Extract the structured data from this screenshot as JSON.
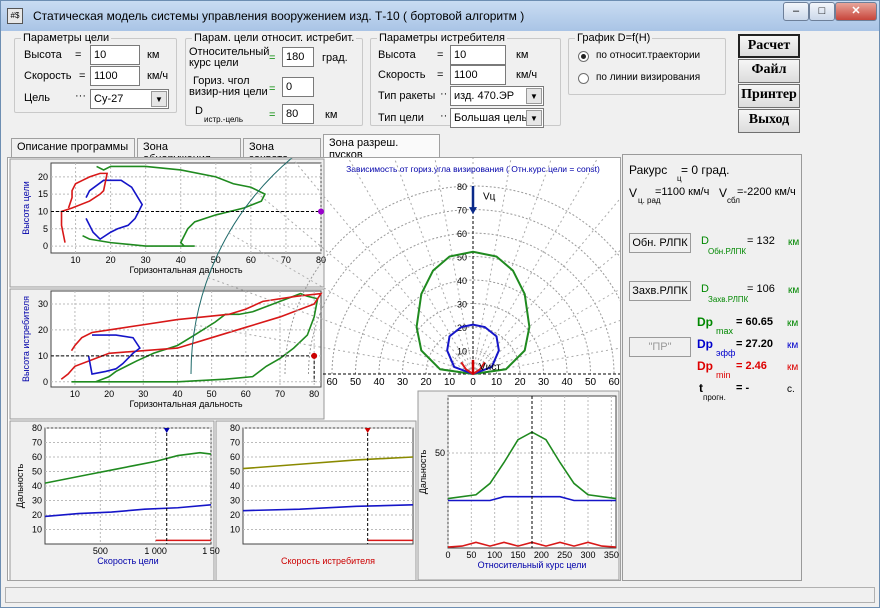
{
  "window": {
    "title": "Статическая модель системы управления вооружением  изд. Т-10  ( бортовой алгоритм )",
    "icon": "#$",
    "min": "–",
    "max": "□",
    "close": "✕"
  },
  "target_params": {
    "title": "Параметры цели",
    "altitude_label": "Высота",
    "altitude_eq": "=",
    "altitude": "10",
    "altitude_unit": "км",
    "speed_label": "Скорость",
    "speed_eq": "=",
    "speed": "1100",
    "speed_unit": "км/ч",
    "target_label": "Цель",
    "target_dots": "···",
    "target": "Су-27"
  },
  "rel_params": {
    "title": "Парам. цели относит. истребит.",
    "course_label1": "Относительный",
    "course_label2": "курс цели",
    "course_eq": "=",
    "course": "180",
    "course_unit": "град.",
    "angle_label1": "Гориз. чгол",
    "angle_label2": "визир-ния цели",
    "angle_eq": "=",
    "angle": "0",
    "d_label": "D",
    "d_sub": "истр.-цель",
    "d_eq": "=",
    "d": "80",
    "d_unit": "км"
  },
  "fighter_params": {
    "title": "Параметры истребителя",
    "altitude_label": "Высота",
    "altitude_eq": "=",
    "altitude": "10",
    "altitude_unit": "км",
    "speed_label": "Скорость",
    "speed_eq": "=",
    "speed": "1100",
    "speed_unit": "км/ч",
    "missile_label": "Тип ракеты",
    "missile_dots": "··",
    "missile": "изд. 470.ЭР",
    "target_type_label": "Тип цели",
    "target_type_dots": "··",
    "target_type": "Большая цель"
  },
  "graph_opts": {
    "title": "График  D=f(H)",
    "opt1": "по относит.траектории",
    "opt2": "по линии визирования",
    "selected": 0
  },
  "buttons": {
    "calc": "Расчет",
    "file": "Файл",
    "printer": "Принтер",
    "exit": "Выход"
  },
  "tabs": [
    "Описание программы",
    "Зона обнаружения",
    "Зона захвата",
    "Зона разреш. пусков"
  ],
  "active_tab": 3,
  "right": {
    "rakurs": "Ракурс",
    "rakurs_sub": "ц",
    "rakurs_val": "= 0 град.",
    "v_label": "V",
    "v_sub": "ц. рад",
    "v_val": "=1100 км/ч",
    "vs_label": "V",
    "vs_sub": "сбл",
    "vs_val": "=-2200 км/ч",
    "obn_btn": "Обн. РЛПК",
    "obn_d": "D",
    "obn_sub": "Обн.РЛПК",
    "obn_val": "=   132",
    "obn_unit": "км",
    "zahv_btn": "Захв.РЛПК",
    "zahv_d": "D",
    "zahv_sub": "Захв.РЛПК",
    "zahv_val": "=   106",
    "zahv_unit": "км",
    "pr_btn": "\"ПР\"",
    "dpmax_l": "Dp",
    "dpmax_s": "max",
    "dpmax_v": "=   60.65",
    "dpmax_u": "км",
    "dpeff_l": "Dp",
    "dpeff_s": "эфф",
    "dpeff_v": "=   27.20",
    "dpeff_u": "км",
    "dpmin_l": "Dp",
    "dpmin_s": "min",
    "dpmin_v": "=    2.46",
    "dpmin_u": "км",
    "t_l": "t",
    "t_s": "прогн.",
    "t_v": "=     -",
    "t_u": "с.",
    "colors": {
      "green": "#008000",
      "blue": "#0000c0",
      "red": "#d00000"
    }
  },
  "charts": {
    "c1": {
      "ylabel": "Высота цели",
      "xlabel": "Горизонтальная дальность",
      "xticks": [
        "10",
        "20",
        "30",
        "40",
        "50",
        "60",
        "70",
        "80"
      ],
      "yticks": [
        "0",
        "5",
        "10",
        "15",
        "20"
      ]
    },
    "c2": {
      "ylabel": "Высота истребителя",
      "xlabel": "Горизонтальная дальность",
      "xticks": [
        "10",
        "20",
        "30",
        "40",
        "50",
        "60",
        "70",
        "80"
      ],
      "yticks": [
        "0",
        "10",
        "20",
        "30"
      ]
    },
    "polar": {
      "title": "Зависимость от гориз.угла визирования ( Отн.курс цели = const)",
      "vc": "Vц",
      "vist": "Vист",
      "r_ticks": [
        "10",
        "20",
        "30",
        "40",
        "50",
        "60",
        "70",
        "80"
      ],
      "x_ticks": [
        "60",
        "50",
        "40",
        "30",
        "20",
        "10",
        "0",
        "10",
        "20",
        "30",
        "40",
        "50",
        "60"
      ]
    },
    "b1": {
      "ylabel": "Дальность",
      "xlabel": "Скорость цели",
      "xticks": [
        "500",
        "1 000",
        "1 50"
      ],
      "yticks": [
        "10",
        "20",
        "30",
        "40",
        "50",
        "60",
        "70",
        "80"
      ]
    },
    "b2": {
      "xlabel": "Скорость истребителя",
      "yticks": [
        "10",
        "20",
        "30",
        "40",
        "50",
        "60",
        "70",
        "80"
      ]
    },
    "b3": {
      "ylabel": "Дальность",
      "xlabel": "Относительный курс цели",
      "xticks": [
        "0",
        "50",
        "100",
        "150",
        "200",
        "250",
        "300",
        "350"
      ],
      "yticks": [
        "50"
      ]
    }
  },
  "chart_data": [
    {
      "type": "line",
      "title": "",
      "xlabel": "Горизонтальная дальность",
      "ylabel": "Высота цели",
      "xlim": [
        3,
        80
      ],
      "ylim": [
        -2,
        24
      ],
      "series": [
        {
          "color": "green",
          "x": [
            16,
            18,
            20,
            30,
            40,
            50,
            55,
            60,
            64,
            63,
            58,
            50,
            44,
            42,
            40,
            41,
            43,
            44,
            40,
            30,
            20,
            14,
            12
          ],
          "y": [
            23,
            22,
            23,
            23,
            22,
            20,
            18,
            17,
            15,
            13,
            11,
            9,
            7,
            5,
            1,
            0,
            0,
            0,
            0,
            0,
            1,
            2,
            3
          ]
        },
        {
          "color": "blue",
          "x": [
            13,
            14,
            18,
            23,
            26,
            29,
            28,
            27,
            25,
            22,
            20,
            17,
            16,
            15,
            13
          ],
          "y": [
            14,
            16,
            19,
            19,
            17,
            12,
            10,
            8,
            6,
            5,
            4,
            2,
            3,
            4,
            8
          ]
        },
        {
          "color": "red",
          "x": [
            7,
            6,
            6,
            9,
            14,
            17,
            18,
            19,
            17,
            14,
            12,
            10,
            9,
            9,
            8
          ],
          "y": [
            1,
            6,
            10,
            11,
            13,
            15,
            16,
            21,
            21,
            20,
            19,
            18,
            16,
            14,
            11
          ]
        }
      ]
    },
    {
      "type": "line",
      "title": "",
      "xlabel": "Горизонтальная дальность",
      "ylabel": "Высота истребителя",
      "xlim": [
        3,
        82
      ],
      "ylim": [
        -2,
        35
      ],
      "series": [
        {
          "color": "green",
          "x": [
            9,
            20,
            40,
            54,
            62,
            66,
            70,
            74,
            78,
            80,
            81,
            78,
            76,
            70,
            62,
            58,
            54,
            51,
            45,
            40,
            33,
            28,
            22,
            20,
            18,
            16,
            12,
            10,
            9
          ],
          "y": [
            0,
            0,
            0,
            1,
            2,
            6,
            9,
            13,
            18,
            25,
            32,
            33,
            34,
            31,
            27,
            26,
            26,
            23,
            18,
            14,
            11,
            8,
            4,
            2,
            1,
            0,
            0,
            0,
            0
          ]
        },
        {
          "color": "red",
          "x": [
            6,
            8,
            10,
            20,
            40,
            50,
            60,
            70,
            80,
            82,
            75,
            65,
            60,
            55,
            40,
            30,
            20,
            15,
            12,
            10,
            9
          ],
          "y": [
            1,
            3,
            6,
            11,
            13,
            17,
            21,
            25,
            30,
            34,
            33,
            31,
            28,
            26,
            24,
            22,
            20,
            19,
            17,
            14,
            12
          ]
        },
        {
          "color": "blue",
          "x": [
            15,
            22,
            27,
            29,
            27,
            24,
            22,
            19,
            15,
            14
          ],
          "y": [
            18,
            18,
            17,
            13,
            11,
            7,
            5,
            4,
            3,
            10
          ]
        }
      ]
    },
    {
      "type": "line",
      "title": "",
      "xlabel": "Скорость цели",
      "ylabel": "Дальность",
      "xlim": [
        0,
        1500
      ],
      "ylim": [
        0,
        80
      ],
      "series": [
        {
          "color": "green",
          "x": [
            0,
            200,
            400,
            600,
            800,
            1000,
            1200,
            1400,
            1500
          ],
          "y": [
            42,
            45,
            48,
            51,
            54,
            57,
            61,
            63,
            62
          ]
        },
        {
          "color": "blue",
          "x": [
            0,
            300,
            600,
            900,
            1200,
            1500
          ],
          "y": [
            19,
            21,
            22,
            24,
            25,
            27
          ]
        },
        {
          "color": "red",
          "x": [
            1000,
            1500
          ],
          "y": [
            2.5,
            2.5
          ]
        }
      ]
    },
    {
      "type": "line",
      "title": "",
      "xlabel": "Скорость истребителя",
      "ylabel": "",
      "xlim": [
        0,
        1500
      ],
      "ylim": [
        0,
        80
      ],
      "series": [
        {
          "color": "olive",
          "x": [
            0,
            500,
            1000,
            1500
          ],
          "y": [
            52,
            55,
            58,
            60
          ]
        },
        {
          "color": "blue",
          "x": [
            0,
            500,
            1000,
            1500
          ],
          "y": [
            23,
            24,
            26,
            27
          ]
        },
        {
          "color": "red",
          "x": [
            1100,
            1500
          ],
          "y": [
            2.5,
            2.5
          ]
        }
      ]
    },
    {
      "type": "line",
      "title": "",
      "xlabel": "Относительный курс цели",
      "ylabel": "Дальность",
      "xlim": [
        0,
        360
      ],
      "ylim": [
        0,
        80
      ],
      "series": [
        {
          "color": "green",
          "x": [
            0,
            60,
            90,
            120,
            150,
            180,
            210,
            240,
            270,
            300,
            360
          ],
          "y": [
            26,
            28,
            34,
            45,
            57,
            61,
            57,
            45,
            34,
            28,
            26
          ]
        },
        {
          "color": "blue",
          "x": [
            0,
            90,
            120,
            240,
            270,
            360
          ],
          "y": [
            25,
            25,
            27,
            27,
            25,
            25
          ]
        },
        {
          "color": "red",
          "x": [
            0,
            30,
            60,
            90,
            120,
            150,
            180,
            210,
            240,
            270,
            300,
            330,
            360
          ],
          "y": [
            0.5,
            1,
            3,
            1,
            3,
            1,
            3,
            1,
            3,
            1,
            3,
            1,
            0.5
          ]
        }
      ]
    },
    {
      "type": "line",
      "title": "Зависимость от гориз.угла визирования ( Отн.курс цели = const)",
      "xlabel": "",
      "ylabel": "",
      "xlim": [
        -60,
        60
      ],
      "ylim": [
        0,
        80
      ],
      "series": [
        {
          "color": "green",
          "x": [
            0,
            -14,
            -22,
            -24,
            -22,
            -17,
            -10,
            0,
            10,
            17,
            22,
            24,
            22,
            14,
            0
          ],
          "y": [
            0,
            2,
            10,
            20,
            34,
            44,
            50,
            52,
            50,
            44,
            34,
            20,
            10,
            2,
            0
          ]
        },
        {
          "color": "blue",
          "x": [
            0,
            -8,
            -11,
            -10,
            -5,
            0,
            5,
            10,
            11,
            8,
            0
          ],
          "y": [
            0,
            3,
            10,
            16,
            20,
            21,
            20,
            16,
            10,
            3,
            0
          ]
        },
        {
          "color": "red",
          "x": [
            -5,
            -3,
            0,
            3,
            5
          ],
          "y": [
            5,
            2,
            0,
            2,
            5
          ]
        }
      ]
    }
  ]
}
